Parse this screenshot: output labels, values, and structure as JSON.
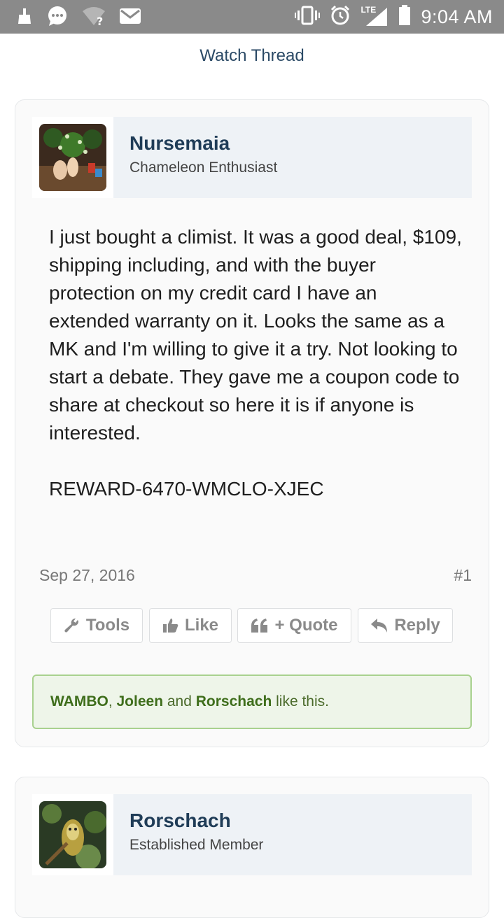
{
  "status_bar": {
    "time": "9:04 AM",
    "network": "LTE",
    "icons": [
      "cleaner-icon",
      "chat-icon",
      "wifi-unknown-icon",
      "mail-icon",
      "vibrate-icon",
      "alarm-icon",
      "signal-icon",
      "battery-icon"
    ]
  },
  "header": {
    "watch_thread": "Watch Thread"
  },
  "posts": [
    {
      "username": "Nursemaia",
      "user_title": "Chameleon Enthusiast",
      "message": "I just bought a climist. It was a good deal, $109, shipping including, and with the buyer protection on my credit card I have an extended warranty on it. Looks the same as a MK and I'm willing to give it a try. Not looking to start a debate. They gave me a coupon code to share at checkout so here it is if anyone is interested.",
      "code": "REWARD-6470-WMCLO-XJEC",
      "date": "Sep 27, 2016",
      "post_number": "#1",
      "actions": {
        "tools": "Tools",
        "like": "Like",
        "quote": "+ Quote",
        "reply": "Reply"
      },
      "likes": {
        "user1": "WAMBO",
        "sep1": ", ",
        "user2": "Joleen",
        "sep2": " and ",
        "user3": "Rorschach",
        "suffix": " like this."
      }
    },
    {
      "username": "Rorschach",
      "user_title": "Established Member"
    }
  ],
  "colors": {
    "username": "#1f3c57",
    "like_border": "#a9d18e",
    "like_bg": "#eef5e9",
    "status_bar": "#8a8a8a"
  }
}
